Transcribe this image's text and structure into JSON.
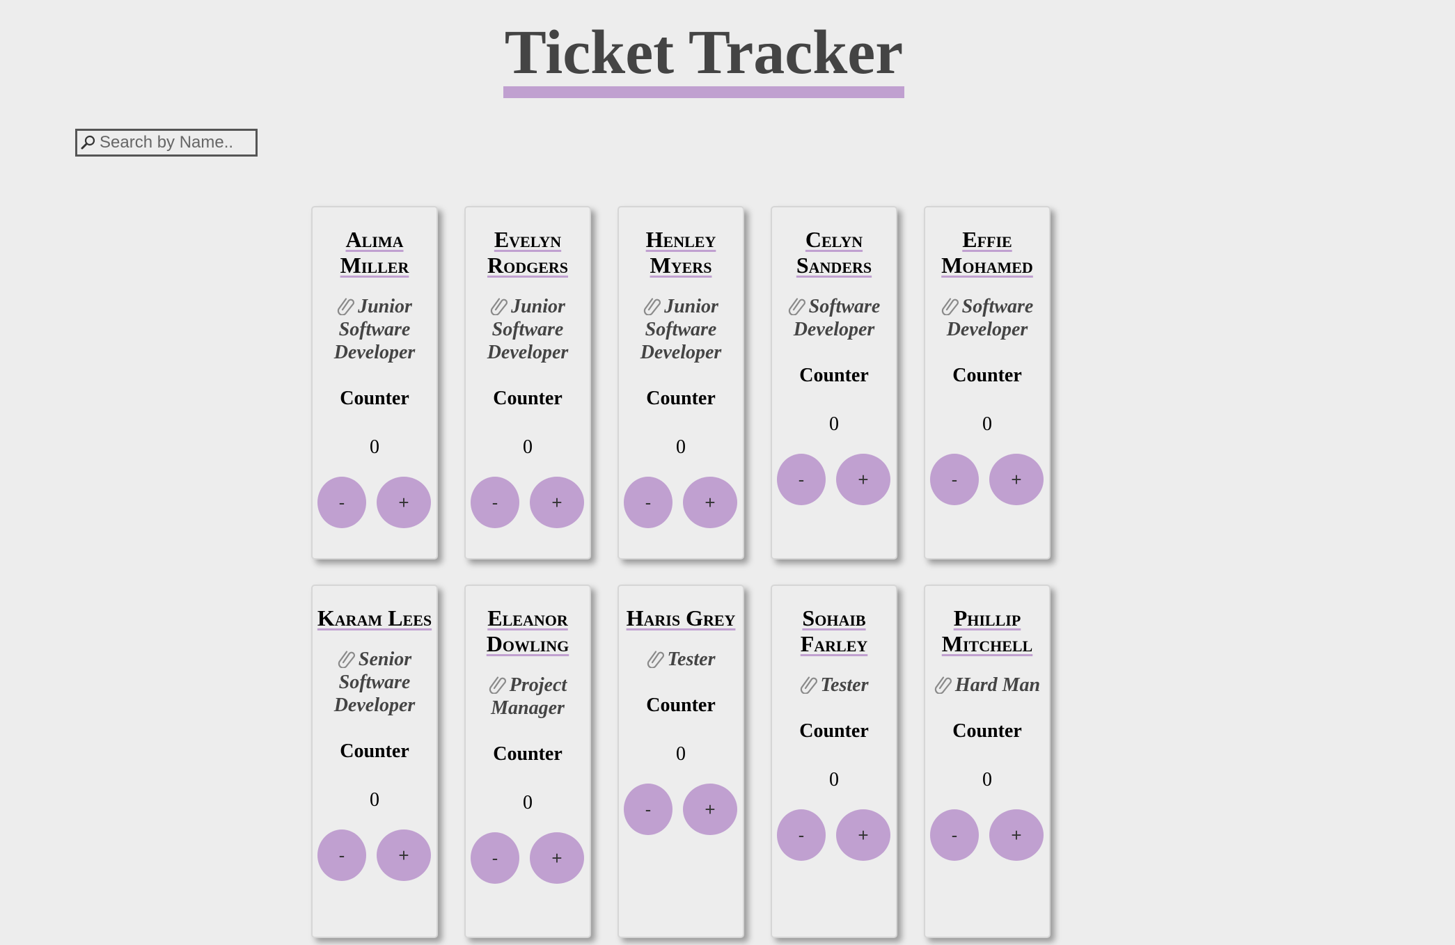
{
  "page": {
    "title": "Ticket Tracker"
  },
  "search": {
    "placeholder": "Search by Name.."
  },
  "colors": {
    "accent": "#c0a0d0",
    "background": "#ededed",
    "title_text": "#444444"
  },
  "icons": {
    "search": "magnifier-icon",
    "role": "paperclip-icon"
  },
  "cards": [
    {
      "name": "Alima Miller",
      "role": "Junior Software Developer",
      "counter_label": "Counter",
      "count": "0",
      "minus": "-",
      "plus": "+"
    },
    {
      "name": "Evelyn Rodgers",
      "role": "Junior Software Developer",
      "counter_label": "Counter",
      "count": "0",
      "minus": "-",
      "plus": "+"
    },
    {
      "name": "Henley Myers",
      "role": "Junior Software Developer",
      "counter_label": "Counter",
      "count": "0",
      "minus": "-",
      "plus": "+"
    },
    {
      "name": "Celyn Sanders",
      "role": "Software Developer",
      "counter_label": "Counter",
      "count": "0",
      "minus": "-",
      "plus": "+"
    },
    {
      "name": "Effie Mohamed",
      "role": "Software Developer",
      "counter_label": "Counter",
      "count": "0",
      "minus": "-",
      "plus": "+"
    },
    {
      "name": "Karam Lees",
      "role": "Senior Software Developer",
      "counter_label": "Counter",
      "count": "0",
      "minus": "-",
      "plus": "+"
    },
    {
      "name": "Eleanor Dowling",
      "role": "Project Manager",
      "counter_label": "Counter",
      "count": "0",
      "minus": "-",
      "plus": "+"
    },
    {
      "name": "Haris Grey",
      "role": "Tester",
      "counter_label": "Counter",
      "count": "0",
      "minus": "-",
      "plus": "+"
    },
    {
      "name": "Sohaib Farley",
      "role": "Tester",
      "counter_label": "Counter",
      "count": "0",
      "minus": "-",
      "plus": "+"
    },
    {
      "name": "Phillip Mitchell",
      "role": "Hard Man",
      "counter_label": "Counter",
      "count": "0",
      "minus": "-",
      "plus": "+"
    }
  ]
}
